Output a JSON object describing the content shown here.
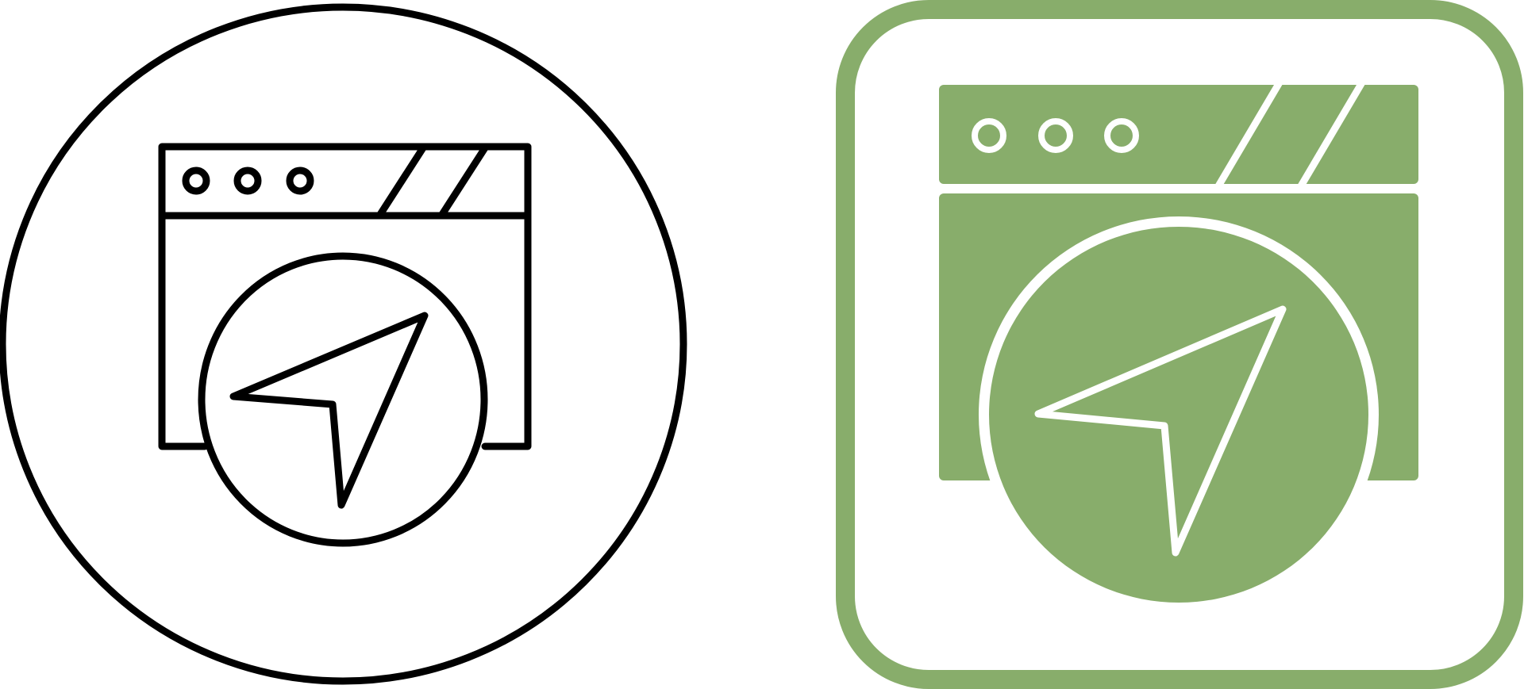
{
  "icons": [
    {
      "name": "browser-navigation-outline-icon",
      "style": "outline",
      "frame": "circle",
      "stroke_color": "#000000",
      "fill_color": "#ffffff"
    },
    {
      "name": "browser-navigation-glyph-icon",
      "style": "filled",
      "frame": "rounded-square",
      "accent_color": "#88ad6b",
      "background_color": "#ffffff"
    }
  ]
}
